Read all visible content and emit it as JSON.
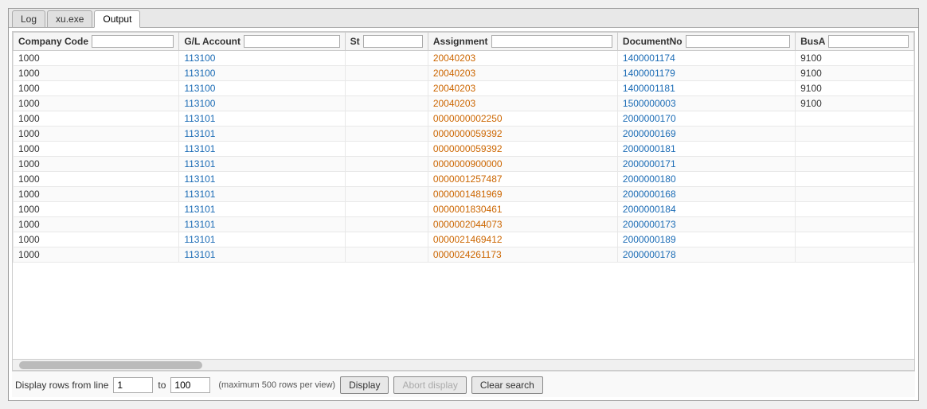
{
  "tabs": [
    {
      "label": "Log",
      "active": false
    },
    {
      "label": "xu.exe",
      "active": false
    },
    {
      "label": "Output",
      "active": true
    }
  ],
  "columns": [
    {
      "id": "company",
      "label": "Company Code",
      "filter": ""
    },
    {
      "id": "gl",
      "label": "G/L Account",
      "filter": ""
    },
    {
      "id": "st",
      "label": "St",
      "filter": ""
    },
    {
      "id": "assignment",
      "label": "Assignment",
      "filter": ""
    },
    {
      "id": "docno",
      "label": "DocumentNo",
      "filter": ""
    },
    {
      "id": "busa",
      "label": "BusA",
      "filter": ""
    }
  ],
  "rows": [
    {
      "company": "1000",
      "gl": "113100",
      "st": "",
      "assignment": "20040203",
      "docno": "1400001174",
      "busa": "9100"
    },
    {
      "company": "1000",
      "gl": "113100",
      "st": "",
      "assignment": "20040203",
      "docno": "1400001179",
      "busa": "9100"
    },
    {
      "company": "1000",
      "gl": "113100",
      "st": "",
      "assignment": "20040203",
      "docno": "1400001181",
      "busa": "9100"
    },
    {
      "company": "1000",
      "gl": "113100",
      "st": "",
      "assignment": "20040203",
      "docno": "1500000003",
      "busa": "9100"
    },
    {
      "company": "1000",
      "gl": "113101",
      "st": "",
      "assignment": "0000000002250",
      "docno": "2000000170",
      "busa": ""
    },
    {
      "company": "1000",
      "gl": "113101",
      "st": "",
      "assignment": "0000000059392",
      "docno": "2000000169",
      "busa": ""
    },
    {
      "company": "1000",
      "gl": "113101",
      "st": "",
      "assignment": "0000000059392",
      "docno": "2000000181",
      "busa": ""
    },
    {
      "company": "1000",
      "gl": "113101",
      "st": "",
      "assignment": "0000000900000",
      "docno": "2000000171",
      "busa": ""
    },
    {
      "company": "1000",
      "gl": "113101",
      "st": "",
      "assignment": "0000001257487",
      "docno": "2000000180",
      "busa": ""
    },
    {
      "company": "1000",
      "gl": "113101",
      "st": "",
      "assignment": "0000001481969",
      "docno": "2000000168",
      "busa": ""
    },
    {
      "company": "1000",
      "gl": "113101",
      "st": "",
      "assignment": "0000001830461",
      "docno": "2000000184",
      "busa": ""
    },
    {
      "company": "1000",
      "gl": "113101",
      "st": "",
      "assignment": "0000002044073",
      "docno": "2000000173",
      "busa": ""
    },
    {
      "company": "1000",
      "gl": "113101",
      "st": "",
      "assignment": "0000021469412",
      "docno": "2000000189",
      "busa": ""
    },
    {
      "company": "1000",
      "gl": "113101",
      "st": "",
      "assignment": "0000024261173",
      "docno": "2000000178",
      "busa": ""
    }
  ],
  "footer": {
    "display_label": "Display rows from line",
    "from_value": "1",
    "to_label": "to",
    "to_value": "100",
    "note": "(maximum 500 rows per view)",
    "display_btn": "Display",
    "abort_btn": "Abort display",
    "clear_btn": "Clear search"
  }
}
